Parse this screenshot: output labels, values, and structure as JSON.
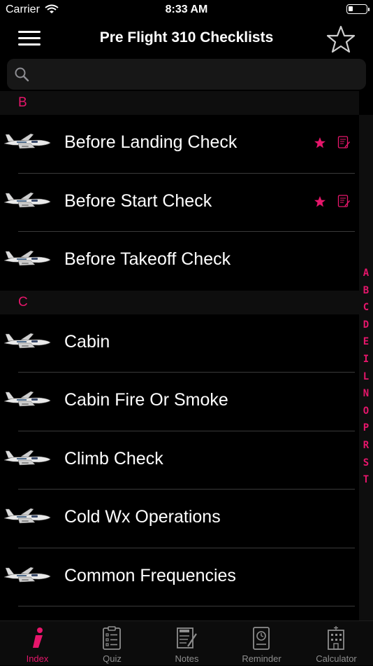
{
  "status_bar": {
    "carrier": "Carrier",
    "time": "8:33 AM"
  },
  "nav": {
    "title": "Pre Flight 310 Checklists"
  },
  "search": {
    "placeholder": ""
  },
  "sections": [
    {
      "letter": "B",
      "items": [
        {
          "label": "Before Landing Check",
          "favorite": true,
          "has_note": true
        },
        {
          "label": "Before Start Check",
          "favorite": true,
          "has_note": true
        },
        {
          "label": "Before Takeoff Check",
          "favorite": false,
          "has_note": false
        }
      ]
    },
    {
      "letter": "C",
      "items": [
        {
          "label": "Cabin",
          "favorite": false,
          "has_note": false
        },
        {
          "label": "Cabin Fire Or Smoke",
          "favorite": false,
          "has_note": false
        },
        {
          "label": "Climb Check",
          "favorite": false,
          "has_note": false
        },
        {
          "label": "Cold Wx Operations",
          "favorite": false,
          "has_note": false
        },
        {
          "label": "Common Frequencies",
          "favorite": false,
          "has_note": false
        }
      ]
    }
  ],
  "index_letters": [
    "A",
    "B",
    "C",
    "D",
    "E",
    "I",
    "L",
    "N",
    "O",
    "P",
    "R",
    "S",
    "T"
  ],
  "tabs": [
    {
      "label": "Index",
      "icon": "info-icon",
      "active": true
    },
    {
      "label": "Quiz",
      "icon": "checklist-icon",
      "active": false
    },
    {
      "label": "Notes",
      "icon": "notes-icon",
      "active": false
    },
    {
      "label": "Reminder",
      "icon": "clock-device-icon",
      "active": false
    },
    {
      "label": "Calculator",
      "icon": "building-icon",
      "active": false
    }
  ],
  "colors": {
    "accent": "#e6166b",
    "background": "#000000",
    "section_header": "#0e0e0e",
    "inactive_tab": "#8e8e8e"
  }
}
